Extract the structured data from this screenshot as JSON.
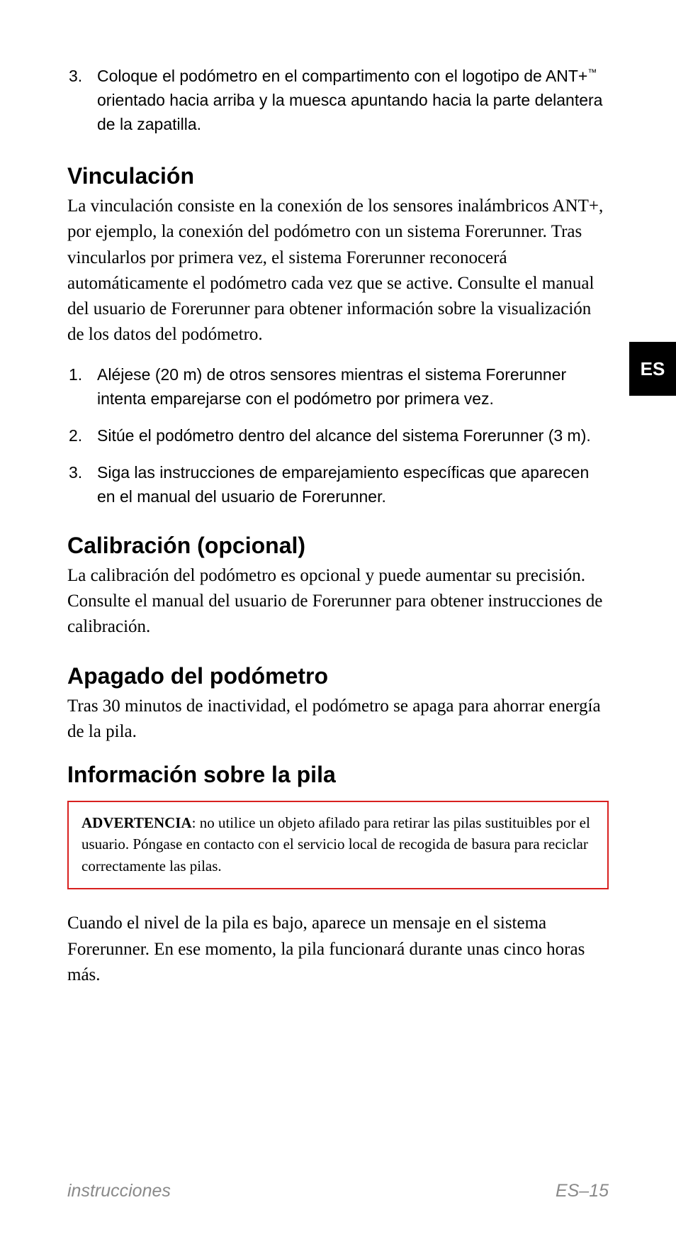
{
  "tab": "ES",
  "install_list": {
    "item3": {
      "num": "3.",
      "text_before": "Coloque el podómetro en el compartimento con el logotipo de ANT+",
      "tm": "™",
      "text_after": " orientado hacia arriba y la muesca apuntando hacia la parte delantera de la zapatilla."
    }
  },
  "vinculacion": {
    "heading": "Vinculación",
    "body": "La vinculación consiste en la conexión de los sensores inalámbricos ANT+, por ejemplo, la conexión del podómetro con un sistema Forerunner. Tras vincularlos por primera vez, el sistema Forerunner reconocerá automáticamente el podómetro cada vez que se active. Consulte el manual del usuario de Forerunner para obtener información sobre la visualización de los datos del podómetro.",
    "steps": {
      "s1": {
        "num": "1.",
        "text": "Aléjese (20 m) de otros sensores mientras el sistema Forerunner intenta emparejarse con el podómetro por primera vez."
      },
      "s2": {
        "num": "2.",
        "text": "Sitúe el podómetro dentro del alcance del sistema Forerunner (3 m)."
      },
      "s3": {
        "num": "3.",
        "text": "Siga las instrucciones de emparejamiento específicas que aparecen en el manual del usuario de Forerunner."
      }
    }
  },
  "calibracion": {
    "heading": "Calibración (opcional)",
    "body": "La calibración del podómetro es opcional y puede aumentar su precisión. Consulte el manual del usuario de Forerunner para obtener instrucciones de calibración."
  },
  "apagado": {
    "heading": "Apagado del podómetro",
    "body": "Tras 30 minutos de inactividad, el podómetro se apaga para ahorrar energía de la pila."
  },
  "pila": {
    "heading": "Información sobre la pila",
    "warning_label": "ADVERTENCIA",
    "warning_text": ": no utilice un objeto afilado para retirar las pilas sustituibles por el usuario. Póngase en contacto con el servicio local de recogida de basura para reciclar correctamente las pilas.",
    "body": "Cuando el nivel de la pila es bajo, aparece un mensaje en el sistema Forerunner. En ese momento, la pila funcionará durante unas cinco horas más."
  },
  "footer": {
    "left": "instrucciones",
    "right": "ES–15"
  }
}
